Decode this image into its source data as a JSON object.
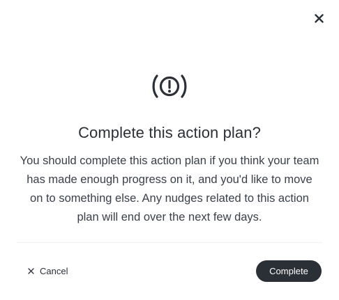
{
  "dialog": {
    "title": "Complete this action plan?",
    "body": "You should complete this action plan if you think your team has made enough progress on it, and you'd like to move on to something else. Any nudges related to this action plan will end over the next few days.",
    "header_icon": "alert-circle-waves-icon",
    "close_icon": "close-icon"
  },
  "footer": {
    "cancel_label": "Cancel",
    "cancel_icon": "close-small-icon",
    "complete_label": "Complete"
  },
  "colors": {
    "primary_dark": "#2b2f36",
    "background": "#ffffff",
    "divider": "#f1f2f4"
  }
}
